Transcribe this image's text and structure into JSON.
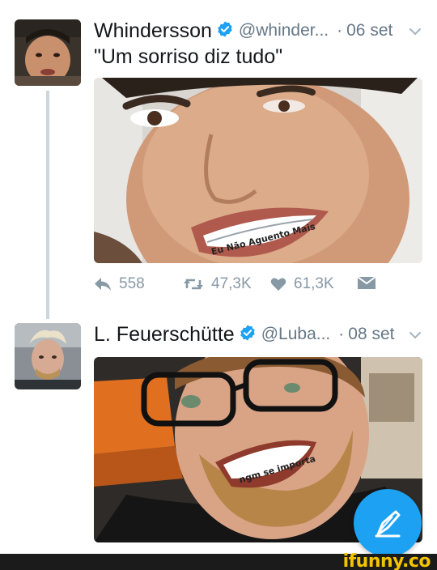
{
  "tweets": [
    {
      "name": "Whindersson",
      "handle": "@whinder...",
      "separator": "·",
      "time": "06 set",
      "text": "\"Um sorriso diz tudo\"",
      "photo_caption": "Eu Não Aguento Mais",
      "actions": {
        "replies": "558",
        "retweets": "47,3K",
        "likes": "61,3K"
      }
    },
    {
      "name": "L. Feuerschütte",
      "handle": "@Luba...",
      "separator": "·",
      "time": "08 set",
      "photo_caption": "ngm se importa"
    }
  ],
  "icons": {
    "verified": "verified-badge-icon",
    "chevron": "chevron-down-icon",
    "reply": "reply-icon",
    "retweet": "retweet-icon",
    "like": "heart-icon",
    "message": "direct-message-icon",
    "compose": "compose-tweet-icon"
  },
  "colors": {
    "accent": "#1da1f2",
    "secondary_text": "#657786",
    "action_grey": "#8899a6",
    "thread_line": "#ccd6dd"
  },
  "watermark": "ifunny.co"
}
